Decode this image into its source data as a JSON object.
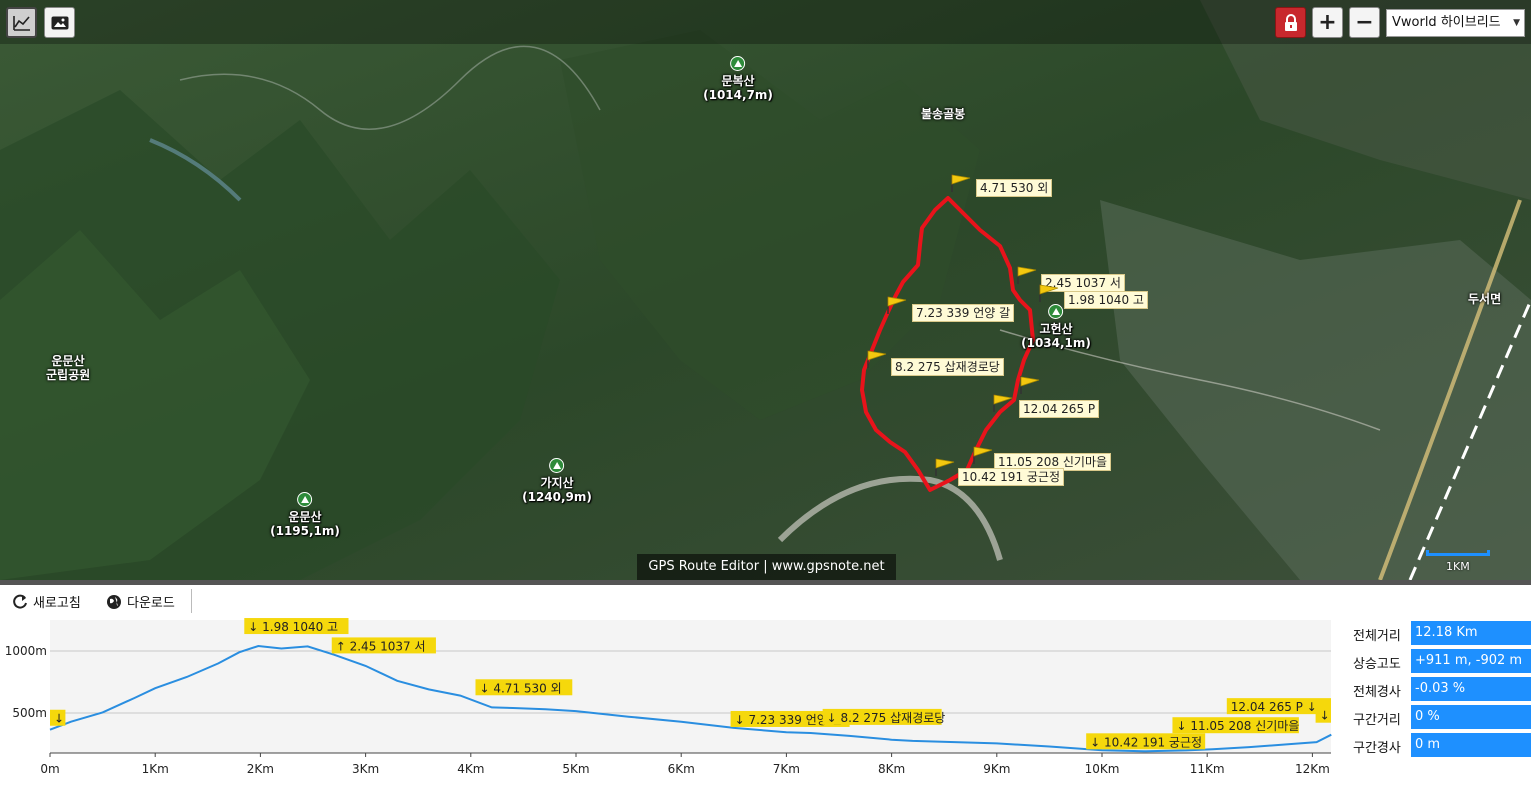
{
  "toolbar": {
    "chart_icon": "chart-icon",
    "image_icon": "image-icon",
    "lock_icon": "lock-icon",
    "zoom_in_label": "+",
    "zoom_out_label": "−",
    "map_type": "Vworld 하이브리드"
  },
  "map": {
    "peaks": [
      {
        "name": "문복산",
        "elev": "(1014,7m)"
      },
      {
        "name": "고헌산",
        "elev": "(1034,1m)"
      },
      {
        "name": "가지산",
        "elev": "(1240,9m)"
      },
      {
        "name": "운문산",
        "elev": "(1195,1m)"
      }
    ],
    "places": [
      "불송골봉",
      "운문산\n군립공원",
      "두서면"
    ],
    "waypoints": [
      "4.71 530 외",
      "2.45 1037 서",
      "1.98 1040 고",
      "7.23 339 언양 갈",
      "8.2 275 삽재경로당",
      "12.04 265 P",
      "11.05 208 신기마을",
      "10.42 191 궁근정"
    ],
    "watermark": "GPS Route Editor | www.gpsnote.net",
    "scale": "1KM",
    "route_color": "#e8131b"
  },
  "profile_toolbar": {
    "refresh": "새로고침",
    "download": "다운로드"
  },
  "stats": [
    {
      "label": "전체거리",
      "value": "12.18 Km"
    },
    {
      "label": "상승고도",
      "value": "+911 m, -902 m"
    },
    {
      "label": "전체경사",
      "value": "-0.03 %"
    },
    {
      "label": "구간거리",
      "value": "0 %"
    },
    {
      "label": "구간경사",
      "value": "0 m"
    }
  ],
  "chart_data": {
    "type": "area",
    "x_unit": "Km",
    "y_unit": "m",
    "xlim": [
      0,
      12.18
    ],
    "ylim": [
      191,
      1040
    ],
    "x_ticks": [
      "0m",
      "1Km",
      "2Km",
      "3Km",
      "4Km",
      "5Km",
      "6Km",
      "7Km",
      "8Km",
      "9Km",
      "10Km",
      "11Km",
      "12Km"
    ],
    "y_ticks": [
      "1000m",
      "500m"
    ],
    "line_color": "#2a8ee0",
    "series": [
      {
        "x": [
          0,
          0.2,
          0.5,
          0.8,
          1.0,
          1.3,
          1.6,
          1.8,
          1.98,
          2.2,
          2.45,
          2.7,
          3.0,
          3.3,
          3.6,
          3.9,
          4.2,
          4.4,
          4.71,
          5.0,
          5.5,
          6.0,
          6.5,
          7.0,
          7.23,
          7.6,
          8.0,
          8.2,
          8.6,
          9.0,
          9.5,
          10.0,
          10.42,
          10.8,
          11.05,
          11.4,
          11.8,
          12.04,
          12.18
        ],
        "y": [
          365,
          430,
          505,
          620,
          700,
          790,
          900,
          990,
          1040,
          1020,
          1037,
          970,
          880,
          760,
          690,
          640,
          545,
          540,
          530,
          515,
          470,
          430,
          380,
          345,
          339,
          315,
          285,
          275,
          265,
          255,
          230,
          200,
          191,
          198,
          208,
          225,
          250,
          265,
          325
        ]
      }
    ],
    "annotations": [
      {
        "x": 0,
        "y": 365,
        "text": "↓"
      },
      {
        "x": 1.98,
        "y": 1040,
        "text": "↓ 1.98 1040 고"
      },
      {
        "x": 2.45,
        "y": 1037,
        "text": "↑ 2.45 1037 서"
      },
      {
        "x": 4.71,
        "y": 530,
        "text": "↓ 4.71 530 외"
      },
      {
        "x": 7.23,
        "y": 339,
        "text": "↓ 7.23 339 언양 갈"
      },
      {
        "x": 8.2,
        "y": 275,
        "text": "↓ 8.2 275 삽재경로당"
      },
      {
        "x": 10.42,
        "y": 191,
        "text": "↓ 10.42 191 궁근정"
      },
      {
        "x": 11.05,
        "y": 208,
        "text": "↓ 11.05 208 신기마을"
      },
      {
        "x": 12.04,
        "y": 265,
        "text": "12.04 265 P ↓"
      },
      {
        "x": 12.18,
        "y": 325,
        "text": "↓"
      }
    ]
  }
}
